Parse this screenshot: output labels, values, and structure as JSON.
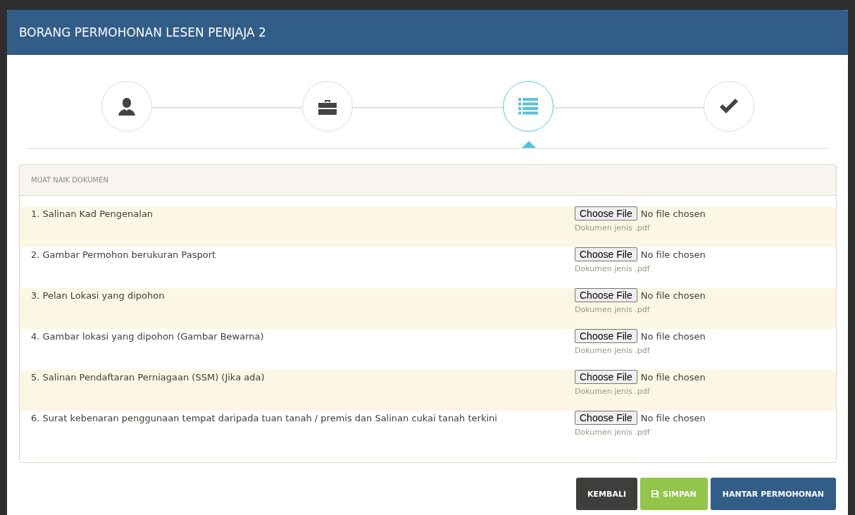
{
  "window": {
    "title": "BORANG PERMOHONAN LESEN PENJAJA 2"
  },
  "steps": [
    {
      "kind": "person",
      "selected": false
    },
    {
      "kind": "briefcase",
      "selected": false
    },
    {
      "kind": "list",
      "selected": true
    },
    {
      "kind": "check",
      "selected": false
    }
  ],
  "panel": {
    "title": "MUAT NAIK DOKUMEN",
    "documents": [
      {
        "label": "1. Salinan Kad Pengenalan",
        "button": "Choose File",
        "status": "No file chosen",
        "hint": "Dokumen jenis .pdf"
      },
      {
        "label": "2. Gambar Permohon berukuran Pasport",
        "button": "Choose File",
        "status": "No file chosen",
        "hint": "Dokumen jenis .pdf"
      },
      {
        "label": "3. Pelan Lokasi yang dipohon",
        "button": "Choose File",
        "status": "No file chosen",
        "hint": "Dokumen jenis .pdf"
      },
      {
        "label": "4. Gambar lokasi yang dipohon (Gambar Bewarna)",
        "button": "Choose File",
        "status": "No file chosen",
        "hint": "Dokumen jenis .pdf"
      },
      {
        "label": "5. Salinan Pendaftaran Perniagaan (SSM) (Jika ada)",
        "button": "Choose File",
        "status": "No file chosen",
        "hint": "Dokumen jenis .pdf"
      },
      {
        "label": "6. Surat kebenaran penggunaan tempat daripada tuan tanah / premis dan Salinan cukai tanah terkini",
        "button": "Choose File",
        "status": "No file chosen",
        "hint": "Dokumen jenis .pdf"
      }
    ]
  },
  "buttons": [
    {
      "label": "KEMBALI",
      "kind": "back"
    },
    {
      "label": "SIMPAN",
      "kind": "save"
    },
    {
      "label": "HANTAR PERMOHONAN",
      "kind": "submit"
    }
  ]
}
